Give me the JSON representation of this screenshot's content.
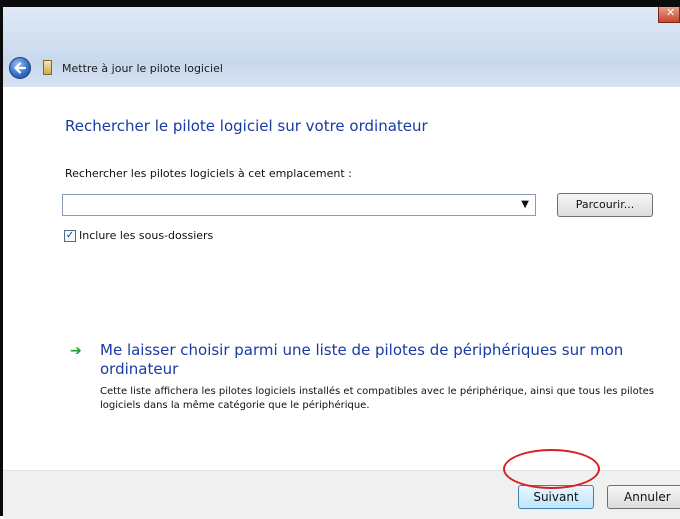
{
  "window": {
    "title": "Mettre à jour le pilote logiciel",
    "close_symbol": "✕"
  },
  "main": {
    "heading": "Rechercher le pilote logiciel sur votre ordinateur",
    "location_label": "Rechercher les pilotes logiciels à cet emplacement :",
    "location_value": "",
    "browse_label": "Parcourir...",
    "include_subfolders_label": "Inclure les sous-dossiers",
    "include_subfolders_checked": true,
    "pick_list_title": "Me laisser choisir parmi une liste de pilotes de périphériques sur mon ordinateur",
    "pick_list_description": "Cette liste affichera les pilotes logiciels installés et compatibles avec le périphérique, ainsi que tous les pilotes logiciels dans la même catégorie que le périphérique."
  },
  "footer": {
    "next_label": "Suivant",
    "cancel_label": "Annuler"
  },
  "colors": {
    "link_blue": "#1a3aa4",
    "arrow_green": "#1f9e2b",
    "annotation_red": "#d91f1f"
  },
  "icons": {
    "back": "back-arrow-icon",
    "title": "driver-icon",
    "close": "close-icon",
    "link": "green-arrow-icon"
  }
}
